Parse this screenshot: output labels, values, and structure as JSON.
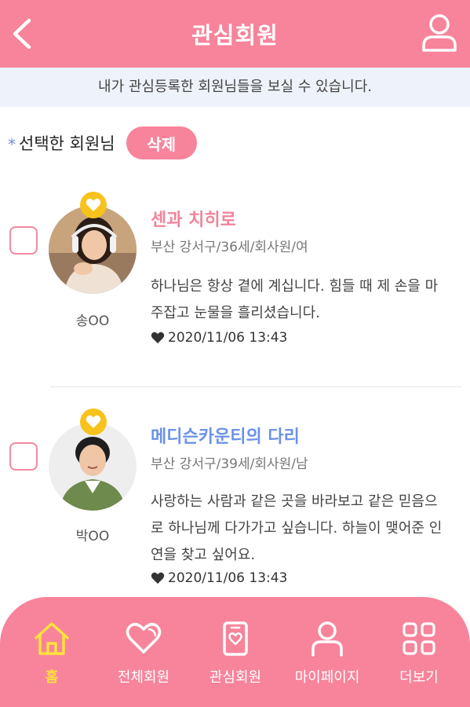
{
  "header": {
    "title": "관심회원"
  },
  "banner": {
    "text": "내가 관심등록한 회원님들을 보실 수 있습니다."
  },
  "selection": {
    "star": "*",
    "label": "선택한 회원님",
    "delete_label": "삭제"
  },
  "members": [
    {
      "nickname": "송OO",
      "name": "센과 치히로",
      "name_color": "#f0849b",
      "meta": "부산 강서구/36세/회사원/여",
      "bio": "하나님은 항상 곁에 계십니다. 힘들 때 제 손을 마주잡고 눈물을 흘리셨습니다.",
      "date": "2020/11/06 13:43"
    },
    {
      "nickname": "박OO",
      "name": "메디슨카운티의 다리",
      "name_color": "#6a92e8",
      "meta": "부산 강서구/39세/회사원/남",
      "bio": "사랑하는 사람과 같은 곳을 바라보고 같은 믿음으로 하나님께 다가가고 싶습니다. 하늘이 맺어준 인연을 찾고 싶어요.",
      "date": "2020/11/06 13:43"
    }
  ],
  "tabbar": {
    "items": [
      {
        "label": "홈",
        "icon": "home-icon",
        "active": true
      },
      {
        "label": "전체회원",
        "icon": "heart-icon",
        "active": false
      },
      {
        "label": "관심회원",
        "icon": "favorite-card-icon",
        "active": false
      },
      {
        "label": "마이페이지",
        "icon": "user-icon",
        "active": false
      },
      {
        "label": "더보기",
        "icon": "grid-icon",
        "active": false
      }
    ]
  },
  "colors": {
    "primary": "#f7849b",
    "accent_yellow": "#f7c21c",
    "active_tab": "#ffe23d",
    "banner_bg": "#eef2fb"
  }
}
